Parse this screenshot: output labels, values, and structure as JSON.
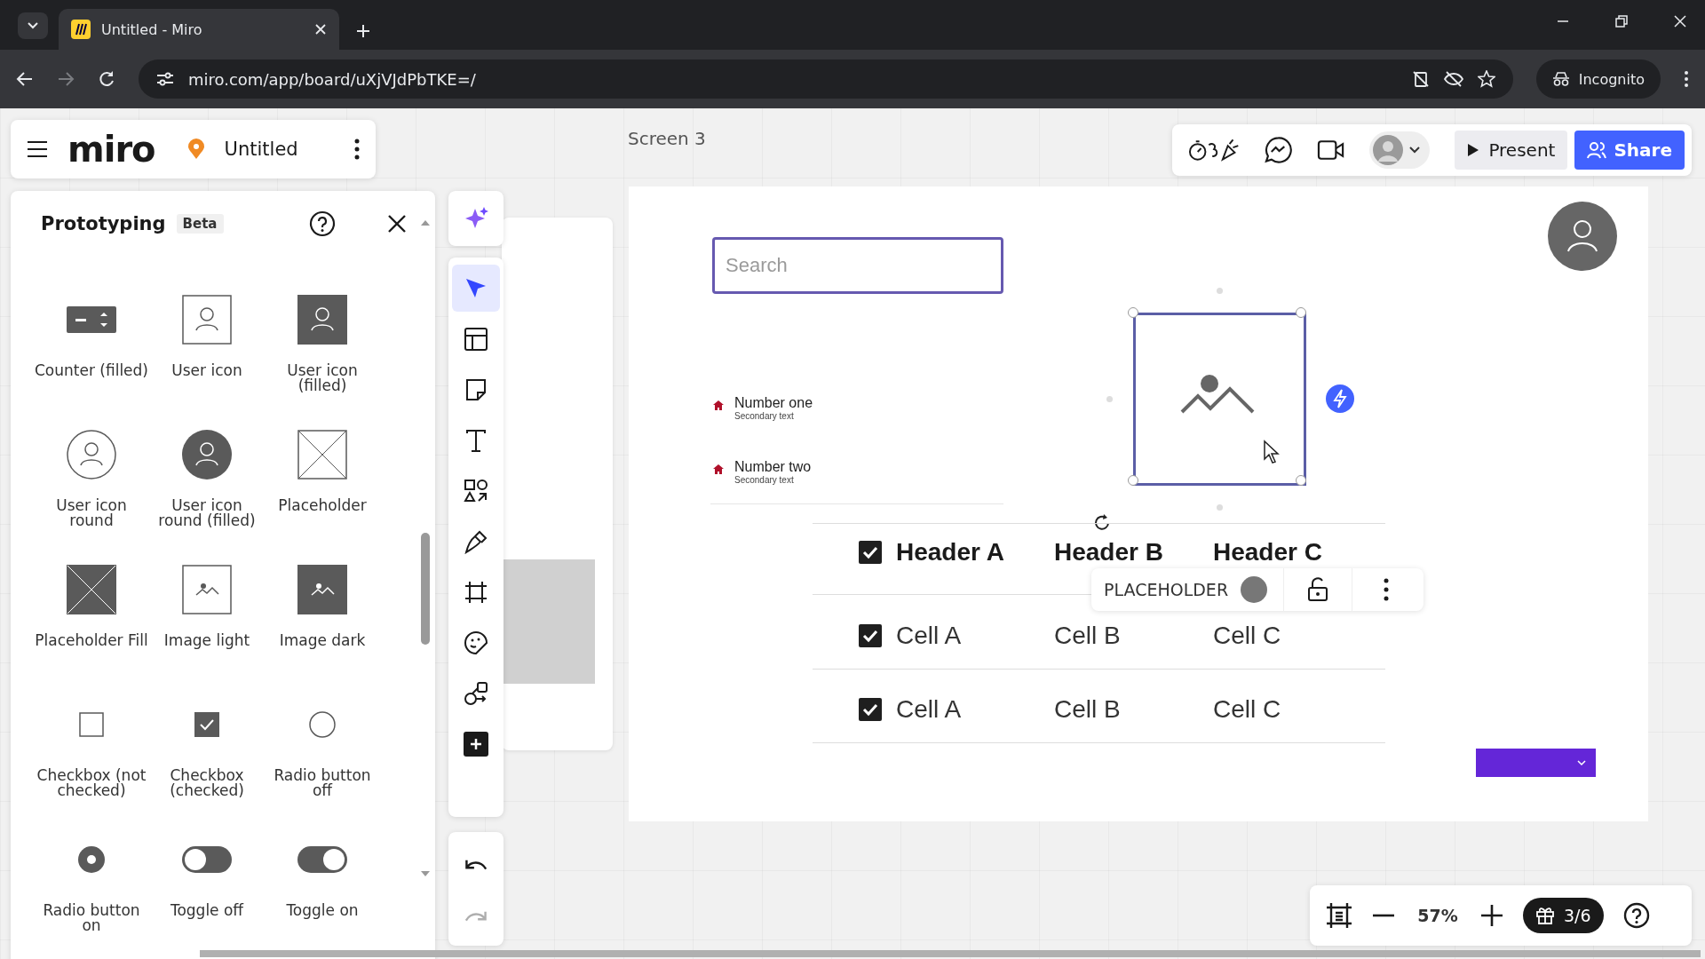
{
  "browser": {
    "tab_title": "Untitled - Miro",
    "url": "miro.com/app/board/uXjVJdPbTKE=/",
    "profile": "Incognito"
  },
  "board": {
    "logo": "miro",
    "title": "Untitled"
  },
  "panel": {
    "title": "Prototyping",
    "badge": "Beta",
    "items": [
      {
        "label": "Counter (filled)",
        "kind": "counter"
      },
      {
        "label": "User icon",
        "kind": "user"
      },
      {
        "label": "User icon (filled)",
        "kind": "user-filled"
      },
      {
        "label": "User icon round",
        "kind": "user-round"
      },
      {
        "label": "User icon round (filled)",
        "kind": "user-round-filled"
      },
      {
        "label": "Placeholder",
        "kind": "placeholder"
      },
      {
        "label": "Placeholder Fill",
        "kind": "placeholder-fill"
      },
      {
        "label": "Image light",
        "kind": "image-light"
      },
      {
        "label": "Image dark",
        "kind": "image-dark"
      },
      {
        "label": "Checkbox (not checked)",
        "kind": "checkbox-off"
      },
      {
        "label": "Checkbox (checked)",
        "kind": "checkbox-on"
      },
      {
        "label": "Radio button off",
        "kind": "radio-off"
      },
      {
        "label": "Radio button on",
        "kind": "radio-on"
      },
      {
        "label": "Toggle off",
        "kind": "toggle-off"
      },
      {
        "label": "Toggle on",
        "kind": "toggle-on"
      }
    ]
  },
  "toolbar": {
    "tools": [
      {
        "kind": "ai",
        "selected": false
      },
      {
        "kind": "select",
        "selected": true
      },
      {
        "kind": "templates",
        "selected": false
      },
      {
        "kind": "sticky-note",
        "selected": false
      },
      {
        "kind": "text",
        "selected": false
      },
      {
        "kind": "shapes",
        "selected": false
      },
      {
        "kind": "pen",
        "selected": false
      },
      {
        "kind": "frame",
        "selected": false
      },
      {
        "kind": "stickers",
        "selected": false
      },
      {
        "kind": "diagram",
        "selected": false
      },
      {
        "kind": "more",
        "selected": false
      }
    ],
    "history": [
      {
        "kind": "undo",
        "disabled": false
      },
      {
        "kind": "redo",
        "disabled": true
      }
    ]
  },
  "top_bar": {
    "present": "Present",
    "share": "Share"
  },
  "frame": {
    "label": "Screen 3",
    "search": {
      "placeholder": "Search"
    },
    "list": [
      {
        "title": "Number one",
        "subtitle": "Secondary text"
      },
      {
        "title": "Number two",
        "subtitle": "Secondary text"
      }
    ],
    "table": {
      "columns": [
        "Header A",
        "Header B",
        "Header C"
      ],
      "header_checked": true,
      "rows": [
        {
          "checked": true,
          "cells": [
            "Cell A",
            "Cell B",
            "Cell C"
          ]
        },
        {
          "checked": true,
          "cells": [
            "Cell A",
            "Cell B",
            "Cell C"
          ]
        }
      ]
    },
    "context_menu": {
      "label": "PLACEHOLDER"
    }
  },
  "zoom": {
    "level": "57%",
    "gift_count": "3/6"
  }
}
